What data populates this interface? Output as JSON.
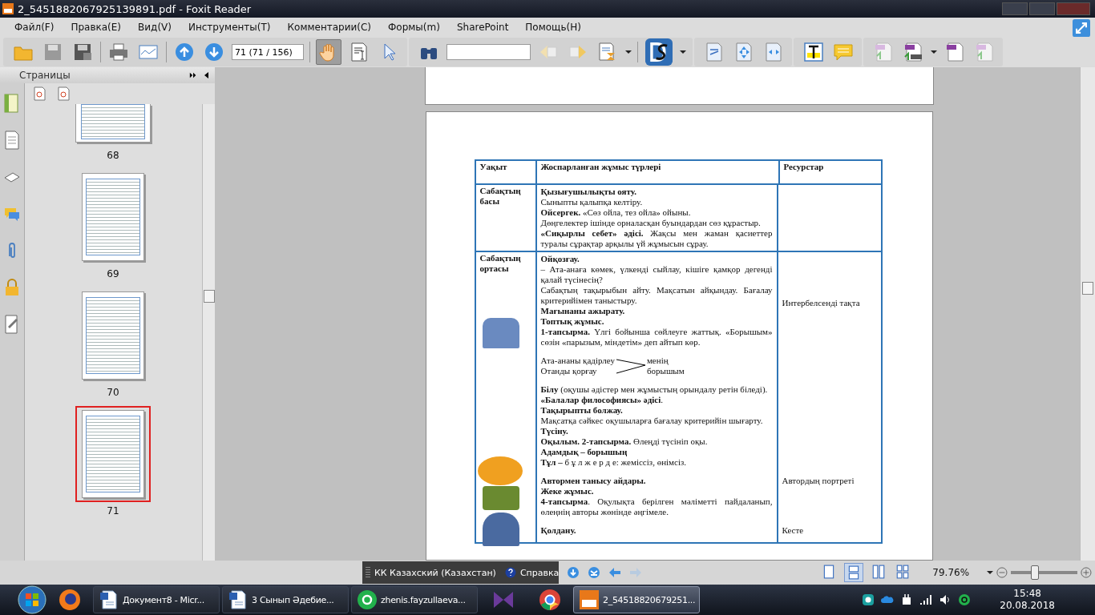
{
  "window": {
    "title": "2_5451882067925139891.pdf - Foxit Reader"
  },
  "menu": [
    "Файл(F)",
    "Правка(E)",
    "Вид(V)",
    "Инструменты(T)",
    "Комментарии(C)",
    "Формы(m)",
    "SharePoint",
    "Помощь(H)"
  ],
  "toolbar": {
    "page_field": "71 (71 / 156)"
  },
  "pages_panel": {
    "title": "Страницы",
    "thumbnails": [
      {
        "label": "68",
        "selected": false
      },
      {
        "label": "69",
        "selected": false
      },
      {
        "label": "70",
        "selected": false
      },
      {
        "label": "71",
        "selected": true
      }
    ]
  },
  "table": {
    "columns": [
      "Уақыт",
      "Жоспарланған жұмыс түрлері",
      "Ресурстар"
    ],
    "rows": [
      {
        "time": "Сабақтың басы",
        "segments": [
          {
            "paragraphs": [
              {
                "kind": "heading",
                "text": "Қызығушылықты ояту."
              },
              {
                "kind": "body",
                "text": "Сыныпты қалыпқа келтіру."
              },
              {
                "kind": "body",
                "text": "**Ойсергек.** «Сөз ойла, тез ойла» ойыны."
              },
              {
                "kind": "body",
                "text": "Дөңгелектер ішінде орналасқан буындардан сөз құрастыр."
              },
              {
                "kind": "body",
                "text": "**«Сиқырлы себет» әдісі.** Жақсы мен жаман қасиеттер туралы сұрақтар арқылы үй жұмысын сұрау."
              }
            ]
          }
        ]
      },
      {
        "time": "Сабақтың ортасы",
        "segments": [
          {
            "resource": "Интербелсенді тақта",
            "paragraphs": [
              {
                "kind": "heading",
                "text": "Ойқозғау."
              },
              {
                "kind": "body",
                "text": "– Ата-анаға көмек, үлкенді сыйлау, кішіге қамқор дегенді қалай түсінесің?"
              },
              {
                "kind": "body",
                "text": "Сабақтың тақырыбын айту. Мақсатын айқындау. Бағалау критерийімен таныстыру."
              },
              {
                "kind": "heading",
                "text": "Мағынаны ажырату."
              },
              {
                "kind": "heading",
                "text": "Топтық жұмыс."
              },
              {
                "kind": "body",
                "text": "**1-тапсырма.** Үлгі бойынша сөйлеуге жаттық. «Борышым» сөзін «парызым, міндетім» деп айтып көр."
              }
            ]
          },
          {
            "diagram": {
              "left": [
                "Ата-ананы қадірлеу",
                "Отанды қорғау"
              ],
              "right": [
                "менің",
                "борышым"
              ]
            }
          },
          {
            "paragraphs": [
              {
                "kind": "body",
                "text": "**Білу** (оқушы әдістер мен жұмыстың орындалу ретін біледі)."
              },
              {
                "kind": "body",
                "text": "**«Балалар философиясы» әдісі**."
              },
              {
                "kind": "heading",
                "text": "Тақырыпты болжау."
              },
              {
                "kind": "body",
                "text": "Мақсатқа сәйкес оқушыларға бағалау критерийін шығарту."
              },
              {
                "kind": "heading",
                "text": "Түсіну."
              },
              {
                "kind": "body",
                "text": "**Оқылым. 2-тапсырма.** Өлеңді түсініп оқы."
              },
              {
                "kind": "heading",
                "text": "Адамдық – борышың"
              },
              {
                "kind": "body",
                "text": "**Тұл –** б ұ л  ж е р д е:  жеміссіз, өнімсіз."
              }
            ]
          },
          {
            "resource": "Автордың портреті",
            "paragraphs": [
              {
                "kind": "heading",
                "text": "Автормен танысу айдары."
              },
              {
                "kind": "heading",
                "text": "Жеке жұмыс."
              },
              {
                "kind": "body",
                "text": "**4-тапсырма**. Оқулықта берілген мәліметті пайдаланып, өлеңнің авторы жөнінде әңгімеле."
              }
            ]
          },
          {
            "resource": "Кесте",
            "paragraphs": [
              {
                "kind": "heading",
                "text": "Қолдану."
              }
            ]
          }
        ]
      }
    ]
  },
  "status_bar": {
    "language": "КК Казахский (Казахстан)",
    "help": "Справка",
    "zoom": "79.76%",
    "zoom_slider": {
      "level": 0.35
    }
  },
  "taskbar": {
    "items": [
      {
        "label": "Документ8 - Micr...",
        "selected": false
      },
      {
        "label": "3 Сынып Әдебие...",
        "selected": false
      },
      {
        "label": "zhenis.fayzullaeva...",
        "selected": false
      },
      {
        "label": "2_54518820679251...",
        "selected": true
      }
    ],
    "time": "15:48",
    "date": "20.08.2018"
  }
}
